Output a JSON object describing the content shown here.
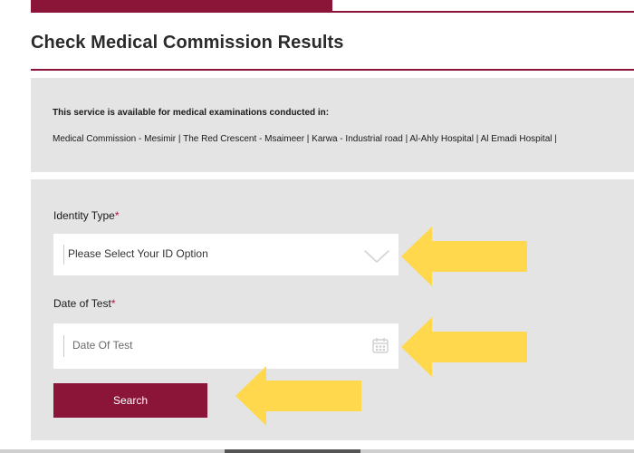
{
  "page": {
    "title": "Check Medical Commission Results"
  },
  "info": {
    "heading": "This service is available for medical examinations conducted in:",
    "locations": "Medical Commission - Mesimir | The Red Crescent - Msaimeer | Karwa - Industrial road | Al-Ahly Hospital | Al Emadi Hospital |"
  },
  "form": {
    "identity_label": "Identity Type",
    "identity_required": "*",
    "identity_placeholder": "Please Select Your ID Option",
    "date_label": "Date of Test",
    "date_required": "*",
    "date_placeholder": "Date Of Test",
    "search_label": "Search"
  },
  "icons": {
    "select": "chevron-down-icon",
    "date": "calendar-icon",
    "annotation": "arrow-left-icon"
  },
  "colors": {
    "brand": "#8a1538",
    "panel": "#e4e4e4",
    "arrow": "#ffd84d",
    "required": "#b3123f"
  }
}
